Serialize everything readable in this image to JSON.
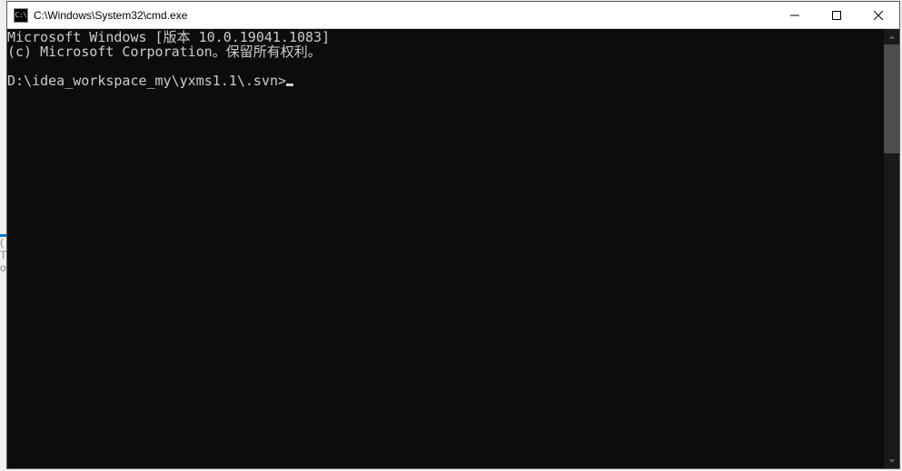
{
  "window": {
    "icon_label": "C:\\",
    "title": "C:\\Windows\\System32\\cmd.exe"
  },
  "terminal": {
    "line1": "Microsoft Windows [版本 10.0.19041.1083]",
    "line2": "(c) Microsoft Corporation。保留所有权利。",
    "blank": "",
    "prompt": "D:\\idea_workspace_my\\yxms1.1\\.svn>"
  }
}
